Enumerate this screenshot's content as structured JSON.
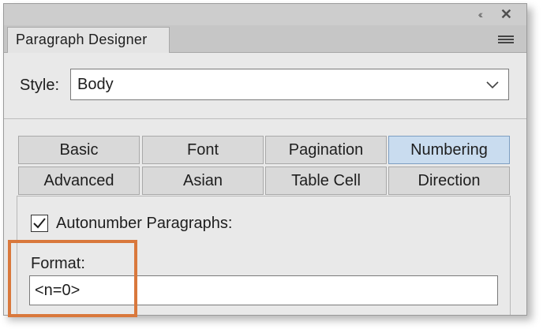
{
  "window": {
    "collapse_glyph": "‹‹",
    "close_glyph": "✕"
  },
  "panel": {
    "title": "Paragraph Designer"
  },
  "style": {
    "label": "Style:",
    "value": "Body"
  },
  "tabs": [
    {
      "label": "Basic",
      "active": false
    },
    {
      "label": "Font",
      "active": false
    },
    {
      "label": "Pagination",
      "active": false
    },
    {
      "label": "Numbering",
      "active": true
    },
    {
      "label": "Advanced",
      "active": false
    },
    {
      "label": "Asian",
      "active": false
    },
    {
      "label": "Table Cell",
      "active": false
    },
    {
      "label": "Direction",
      "active": false
    }
  ],
  "numbering": {
    "autonumber_label": "Autonumber Paragraphs:",
    "autonumber_checked": true,
    "format_label": "Format:",
    "format_value": "<n=0>"
  },
  "colors": {
    "highlight": "#d9783c",
    "active_tab": "#c9dcef"
  }
}
